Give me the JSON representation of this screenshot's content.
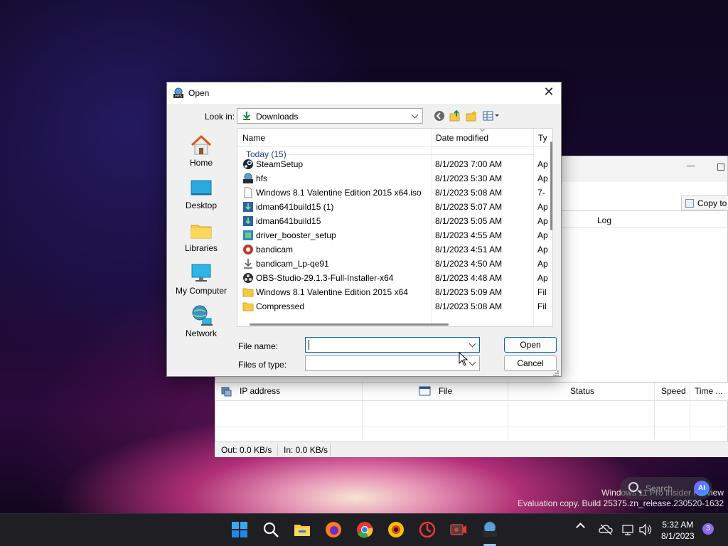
{
  "dialog": {
    "title": "Open",
    "look_in_label": "Look in:",
    "look_in_value": "Downloads",
    "places": [
      {
        "label": "Home",
        "icon": "home-icon"
      },
      {
        "label": "Desktop",
        "icon": "desktop-icon"
      },
      {
        "label": "Libraries",
        "icon": "libraries-icon"
      },
      {
        "label": "My Computer",
        "icon": "computer-icon"
      },
      {
        "label": "Network",
        "icon": "network-icon"
      }
    ],
    "columns": {
      "name": "Name",
      "date": "Date modified",
      "type": "Ty"
    },
    "group": "Today (15)",
    "files": [
      {
        "name": "SteamSetup",
        "date": "8/1/2023 7:00 AM",
        "type": "Ap",
        "icon": "steam-icon"
      },
      {
        "name": "hfs",
        "date": "8/1/2023 5:30 AM",
        "type": "Ap",
        "icon": "hfs-icon"
      },
      {
        "name": "Windows 8.1 Valentine Edition 2015 x64.iso",
        "date": "8/1/2023 5:08 AM",
        "type": "7-",
        "icon": "file-icon"
      },
      {
        "name": "idman641build15 (1)",
        "date": "8/1/2023 5:07 AM",
        "type": "Ap",
        "icon": "idm-icon"
      },
      {
        "name": "idman641build15",
        "date": "8/1/2023 5:05 AM",
        "type": "Ap",
        "icon": "idm-icon"
      },
      {
        "name": "driver_booster_setup",
        "date": "8/1/2023 4:55 AM",
        "type": "Ap",
        "icon": "installer-icon"
      },
      {
        "name": "bandicam",
        "date": "8/1/2023 4:51 AM",
        "type": "Ap",
        "icon": "bandicam-icon"
      },
      {
        "name": "bandicam_Lp-qe91",
        "date": "8/1/2023 4:50 AM",
        "type": "Ap",
        "icon": "download-icon"
      },
      {
        "name": "OBS-Studio-29.1.3-Full-Installer-x64",
        "date": "8/1/2023 4:48 AM",
        "type": "Ap",
        "icon": "obs-icon"
      },
      {
        "name": "Windows 8.1 Valentine Edition 2015 x64",
        "date": "8/1/2023 5:09 AM",
        "type": "Fil",
        "icon": "folder-icon"
      },
      {
        "name": "Compressed",
        "date": "8/1/2023 5:08 AM",
        "type": "Fil",
        "icon": "folder-icon"
      }
    ],
    "file_name_label": "File name:",
    "file_name_value": "",
    "files_of_type_label": "Files of type:",
    "files_of_type_value": "",
    "open_label": "Open",
    "cancel_label": "Cancel"
  },
  "background_app": {
    "copy_label": "Copy to",
    "log_label": "Log",
    "columns": [
      "IP address",
      "File",
      "Status",
      "Speed",
      "Time ..."
    ],
    "status_out": "Out: 0.0 KB/s",
    "status_in": "In: 0.0 KB/s"
  },
  "watermark": {
    "line1": "Windows 11 Pro Insider Preview",
    "line2": "Evaluation copy. Build 25375.zn_release.230520-1632"
  },
  "search": {
    "placeholder": "Search",
    "ai_label": "AI"
  },
  "taskbar": {
    "time": "5:32 AM",
    "date": "8/1/2023",
    "notification_count": "3",
    "accent": "#0067c0"
  }
}
